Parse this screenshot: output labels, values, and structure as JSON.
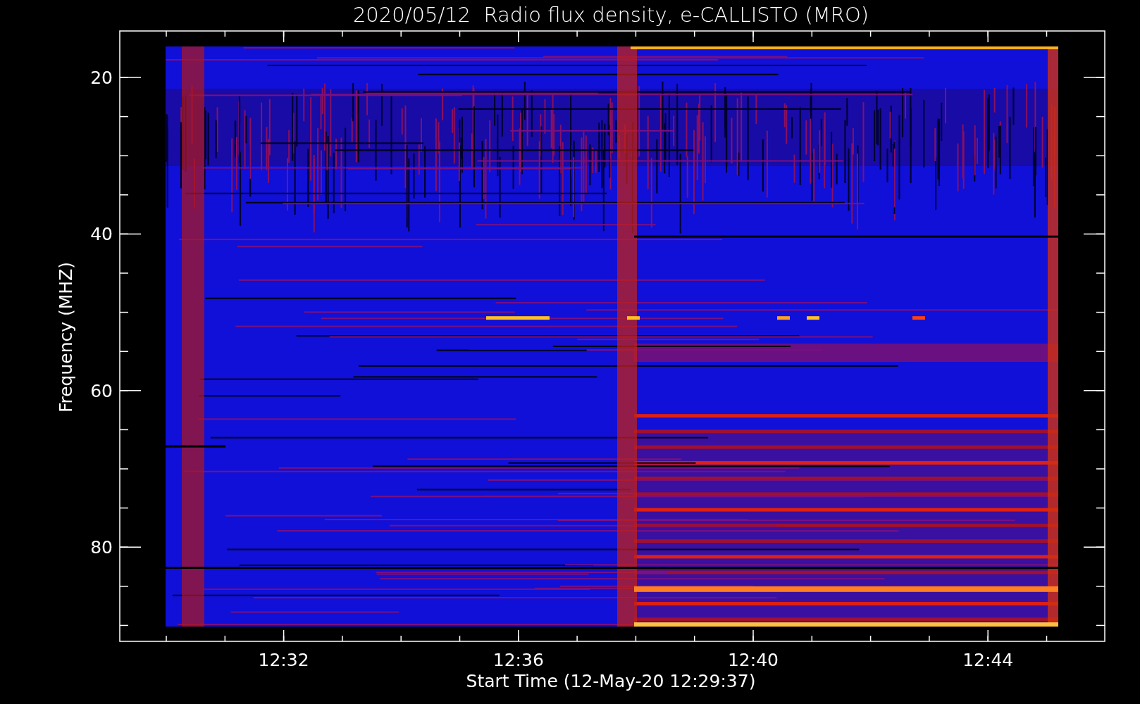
{
  "plot": {
    "title": "2020/05/12  Radio flux density, e-CALLISTO (MRO)",
    "xlabel": "Start Time (12-May-20 12:29:37)",
    "ylabel": "Frequency (MHZ)",
    "xticks": [
      "12:32",
      "12:36",
      "12:40",
      "12:44"
    ],
    "yticks": [
      "20",
      "40",
      "60",
      "80"
    ]
  }
}
